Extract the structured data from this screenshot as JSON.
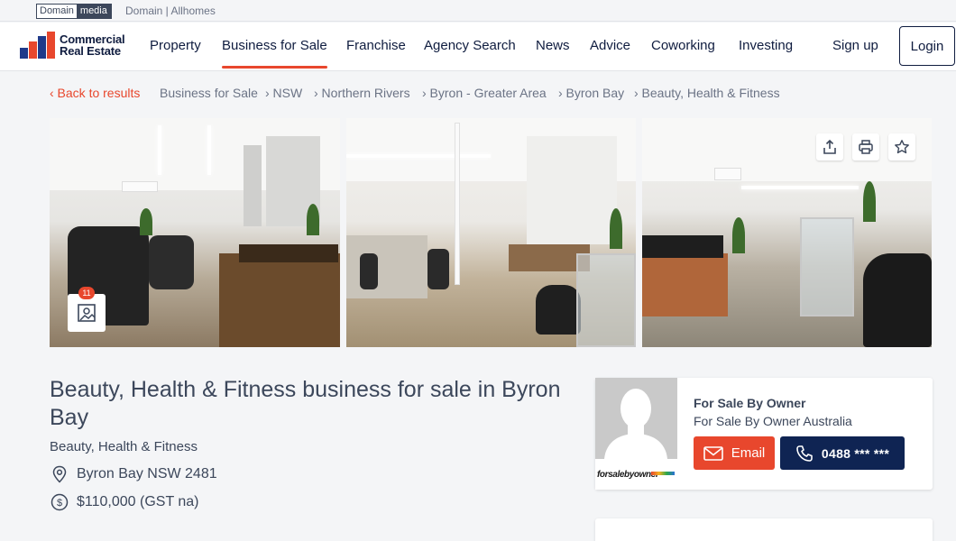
{
  "topbar": {
    "brand_left": "Domain",
    "brand_right": "media",
    "links": "Domain | Allhomes"
  },
  "nav": {
    "logo_line1": "Commercial",
    "logo_line2": "Real Estate",
    "items": [
      "Property",
      "Business for Sale",
      "Franchise",
      "Agency Search",
      "News",
      "Advice",
      "Coworking",
      "Investing"
    ],
    "active_item": "Business for Sale",
    "signup": "Sign up",
    "login": "Login"
  },
  "breadcrumb": {
    "back": "‹ Back to results",
    "items": [
      "Business for Sale",
      "› NSW",
      "› Northern Rivers",
      "› Byron - Greater Area",
      "› Byron Bay",
      "› Beauty, Health & Fitness"
    ]
  },
  "gallery": {
    "photo_count": "11"
  },
  "listing": {
    "title": "Beauty, Health & Fitness business for sale in Byron Bay",
    "category": "Beauty, Health & Fitness",
    "location": "Byron Bay NSW 2481",
    "price": "$110,000 (GST na)"
  },
  "agent": {
    "name": "For Sale By Owner",
    "agency": "For Sale By Owner Australia",
    "logo_text": "forsalebyowner",
    "email_label": "Email",
    "phone_label": "0488 *** ***"
  },
  "colors": {
    "accent": "#e8472d",
    "navy": "#0f2453",
    "text": "#3c475b"
  }
}
